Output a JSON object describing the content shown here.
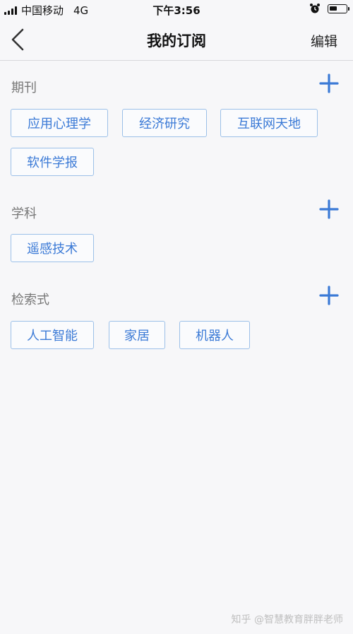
{
  "status_bar": {
    "carrier": "中国移动",
    "network": "4G",
    "time": "下午3:56"
  },
  "nav": {
    "title": "我的订阅",
    "edit_label": "编辑",
    "back_icon": "chevron-left-icon"
  },
  "sections": [
    {
      "title": "期刊",
      "tags": [
        "应用心理学",
        "经济研究",
        "互联网天地",
        "软件学报"
      ]
    },
    {
      "title": "学科",
      "tags": [
        "遥感技术"
      ]
    },
    {
      "title": "检索式",
      "tags": [
        "人工智能",
        "家居",
        "机器人"
      ]
    }
  ],
  "watermark": "知乎 @智慧教育胖胖老师",
  "colors": {
    "accent": "#3b7ad6",
    "tag_border": "#9cc0e8",
    "section_title": "#777777",
    "background": "#f7f7f9"
  }
}
